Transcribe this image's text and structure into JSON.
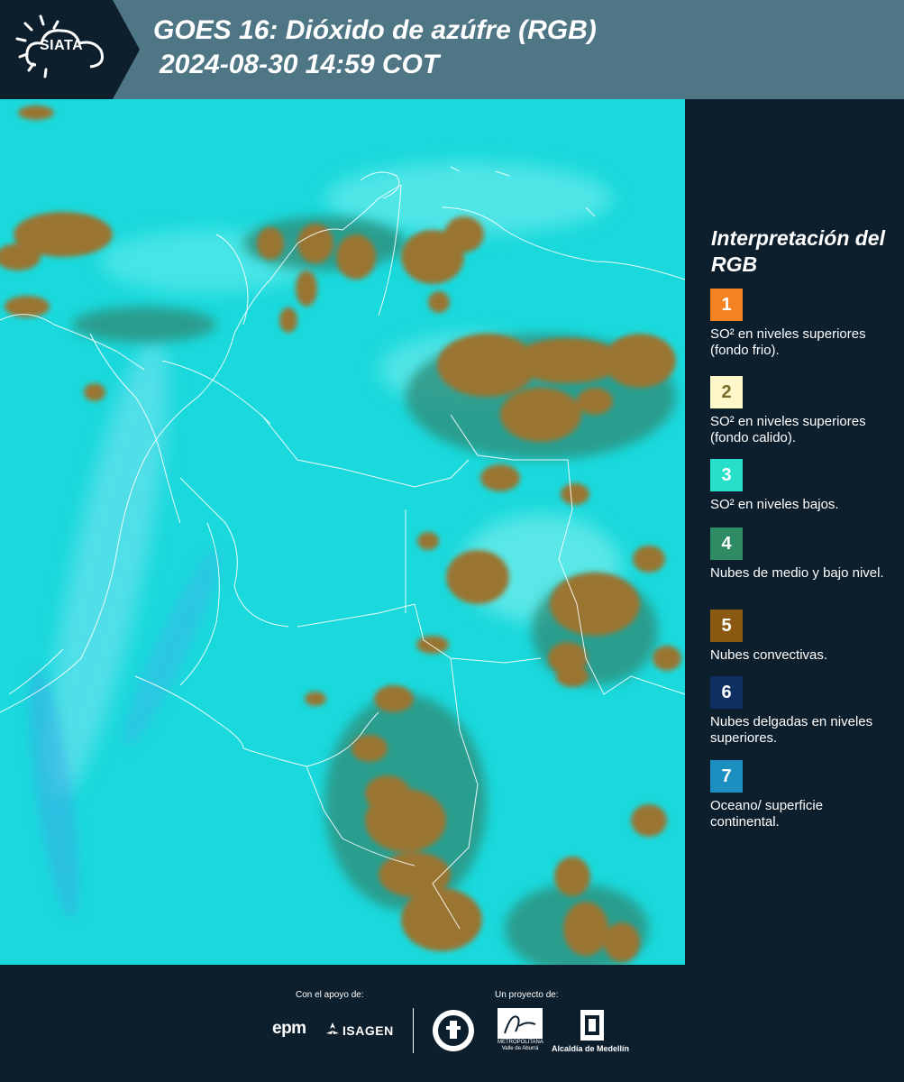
{
  "header": {
    "logo_text": "SIATA",
    "title_line1": "GOES 16: Dióxido de azúfre (RGB)",
    "title_line2": "2024-08-30 14:59 COT",
    "colors": {
      "header_bg": "#4f7684",
      "logo_bg": "#0d1f2d"
    }
  },
  "map": {
    "colors": {
      "background": "#19dde0",
      "convective_clouds": "#9a7432",
      "thin_clouds": "#2a7f7a",
      "borders": "#ffffff"
    }
  },
  "legend": {
    "title": "Interpretación del RGB",
    "items": [
      {
        "number": "1",
        "color": "#f58220",
        "label": "SO² en niveles superiores (fondo frio)."
      },
      {
        "number": "2",
        "color": "#fdf7c9",
        "label": "SO² en niveles superiores (fondo calido)."
      },
      {
        "number": "3",
        "color": "#26e0c9",
        "label": "SO² en niveles bajos."
      },
      {
        "number": "4",
        "color": "#2e8b63",
        "label": "Nubes de medio y bajo nivel."
      },
      {
        "number": "5",
        "color": "#8a5a12",
        "label": "Nubes convectivas."
      },
      {
        "number": "6",
        "color": "#0f2f63",
        "label": "Nubes delgadas en niveles superiores."
      },
      {
        "number": "7",
        "color": "#1b8fbf",
        "label": "Oceano/ superficie continental."
      }
    ]
  },
  "footer": {
    "support_label": "Con el apoyo de:",
    "project_label": "Un proyecto de:",
    "sponsor1": "epm",
    "sponsor2": "ISAGEN",
    "area_caption": "METROPOLITANA Valle de Aburrá",
    "alcaldia": "Alcaldía de Medellín",
    "icons": [
      "siata-logo",
      "epm-logo",
      "isagen-logo",
      "university-seal",
      "area-metropolitana-logo",
      "alcaldia-medellin-seal"
    ]
  }
}
